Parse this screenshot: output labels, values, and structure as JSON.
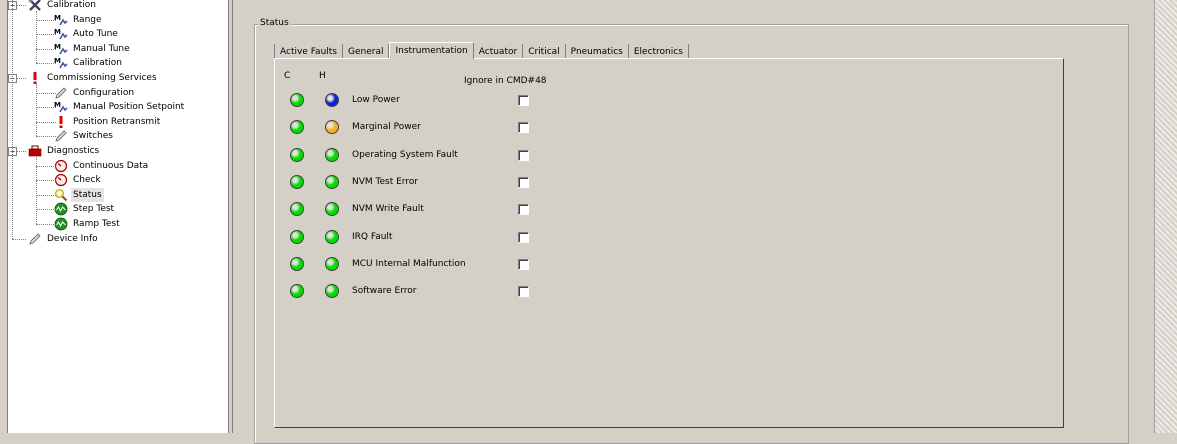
{
  "tree": {
    "items": [
      {
        "label": "Calibration",
        "icon": "tools-icon",
        "level": 0,
        "expanded": true
      },
      {
        "label": "Range",
        "icon": "method-icon",
        "level": 1
      },
      {
        "label": "Auto Tune",
        "icon": "method-icon",
        "level": 1
      },
      {
        "label": "Manual Tune",
        "icon": "method-icon",
        "level": 1
      },
      {
        "label": "Calibration",
        "icon": "method-icon",
        "level": 1
      },
      {
        "label": "Commissioning Services",
        "icon": "warning-exclamation-icon",
        "level": 0,
        "expanded": true
      },
      {
        "label": "Configuration",
        "icon": "pencil-icon",
        "level": 1
      },
      {
        "label": "Manual Position Setpoint",
        "icon": "method-icon",
        "level": 1
      },
      {
        "label": "Position Retransmit",
        "icon": "warning-exclamation-icon",
        "level": 1
      },
      {
        "label": "Switches",
        "icon": "pencil-icon",
        "level": 1
      },
      {
        "label": "Diagnostics",
        "icon": "toolbox-icon",
        "level": 0,
        "expanded": true
      },
      {
        "label": "Continuous Data",
        "icon": "gauge-icon",
        "level": 1
      },
      {
        "label": "Check",
        "icon": "gauge-icon",
        "level": 1
      },
      {
        "label": "Status",
        "icon": "magnifier-icon",
        "level": 1,
        "selected": true
      },
      {
        "label": "Step Test",
        "icon": "waveform-icon",
        "level": 1
      },
      {
        "label": "Ramp Test",
        "icon": "waveform-icon",
        "level": 1
      },
      {
        "label": "Device Info",
        "icon": "pencil-icon",
        "level": 0
      }
    ]
  },
  "status": {
    "group_title": "Status",
    "tabs": [
      "Active Faults",
      "General",
      "Instrumentation",
      "Actuator",
      "Critical",
      "Pneumatics",
      "Electronics"
    ],
    "active_tab": "Instrumentation",
    "col_c": "C",
    "col_h": "H",
    "col_ignore": "Ignore in CMD#48",
    "rows": [
      {
        "label": "Low Power",
        "c_color": "#00e000",
        "h_color": "#0a20d8",
        "ignore": false
      },
      {
        "label": "Marginal Power",
        "c_color": "#00e000",
        "h_color": "#f0b020",
        "ignore": false
      },
      {
        "label": "Operating System Fault",
        "c_color": "#00e000",
        "h_color": "#00e000",
        "ignore": false
      },
      {
        "label": "NVM Test Error",
        "c_color": "#00e000",
        "h_color": "#00e000",
        "ignore": false
      },
      {
        "label": "NVM Write Fault",
        "c_color": "#00e000",
        "h_color": "#00e000",
        "ignore": false
      },
      {
        "label": "IRQ Fault",
        "c_color": "#00e000",
        "h_color": "#00e000",
        "ignore": false
      },
      {
        "label": "MCU Internal Malfunction",
        "c_color": "#00e000",
        "h_color": "#00e000",
        "ignore": false
      },
      {
        "label": "Software Error",
        "c_color": "#00e000",
        "h_color": "#00e000",
        "ignore": false
      }
    ]
  }
}
